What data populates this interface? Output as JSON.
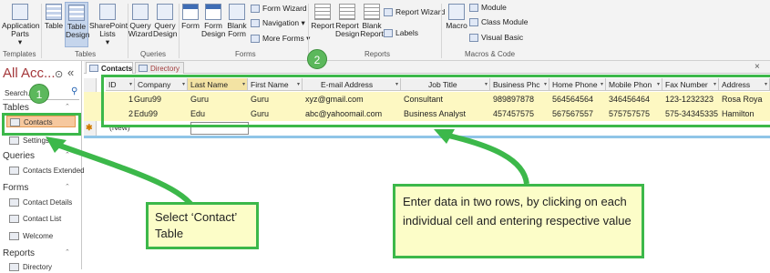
{
  "ribbon": {
    "buttons": [
      {
        "label": "Application Parts",
        "caret": "▾"
      },
      {
        "label": "Table"
      },
      {
        "label": "Table Design"
      },
      {
        "label": "SharePoint Lists",
        "caret": "▾"
      },
      {
        "label": "Query Wizard"
      },
      {
        "label": "Query Design"
      },
      {
        "label": "Form"
      },
      {
        "label": "Form Design"
      },
      {
        "label": "Blank Form"
      },
      {
        "label": "Report"
      },
      {
        "label": "Report Design"
      },
      {
        "label": "Blank Report"
      },
      {
        "label": "Macro"
      }
    ],
    "small": [
      {
        "label": "Form Wizard"
      },
      {
        "label": "Navigation ▾"
      },
      {
        "label": "More Forms ▾"
      },
      {
        "label": "Report Wizard"
      },
      {
        "label": "Labels"
      },
      {
        "label": "Module"
      },
      {
        "label": "Class Module"
      },
      {
        "label": "Visual Basic"
      }
    ],
    "groups": [
      "Templates",
      "Tables",
      "Queries",
      "Forms",
      "Reports",
      "Macros & Code"
    ]
  },
  "nav": {
    "title": "All Acc...",
    "collapse_glyph": "«",
    "menu_glyph": "⊙",
    "search_placeholder": "Search...",
    "search_icon": "⚲",
    "sections": [
      {
        "label": "Tables",
        "items": [
          "Contacts",
          "Settings"
        ]
      },
      {
        "label": "Queries",
        "items": [
          "Contacts Extended"
        ]
      },
      {
        "label": "Forms",
        "items": [
          "Contact Details",
          "Contact List",
          "Welcome"
        ]
      },
      {
        "label": "Reports",
        "items": [
          "Directory"
        ]
      }
    ],
    "chevron": "⌃"
  },
  "tabs": [
    {
      "label": "Contacts",
      "active": true
    },
    {
      "label": "Directory",
      "active": false
    }
  ],
  "tab_close": "×",
  "table": {
    "columns": [
      "ID",
      "Company",
      "Last Name",
      "First Name",
      "E-mail Address",
      "Job Title",
      "Business Phc",
      "Home Phone",
      "Mobile Phon",
      "Fax Number",
      "Address"
    ],
    "rows": [
      [
        "1",
        "Guru99",
        "Guru",
        "Guru",
        "xyz@gmail.com",
        "Consultant",
        "989897878",
        "564564564",
        "346456464",
        "123-1232323",
        "Rosa Roya"
      ],
      [
        "2",
        "Edu99",
        "Edu",
        "Guru",
        "abc@yahoomail.com",
        "Business Analyst",
        "457457575",
        "567567557",
        "575757575",
        "575-34345335",
        "Hamilton"
      ]
    ],
    "new_row_marker": "✱",
    "new_row_label": "(New)",
    "dropdown_glyph": "▾"
  },
  "annotations": {
    "badge1": "1",
    "badge2": "2",
    "callout_contact": "Select ‘Contact’ Table",
    "callout_enter": "Enter data in two rows, by clicking on each individual cell and entering respective value"
  },
  "colors": {
    "annotation_green": "#3cb84a",
    "callout_fill": "#fcfdc8",
    "accent_red": "#a4373a",
    "row_highlight": "#fdf8c2"
  }
}
